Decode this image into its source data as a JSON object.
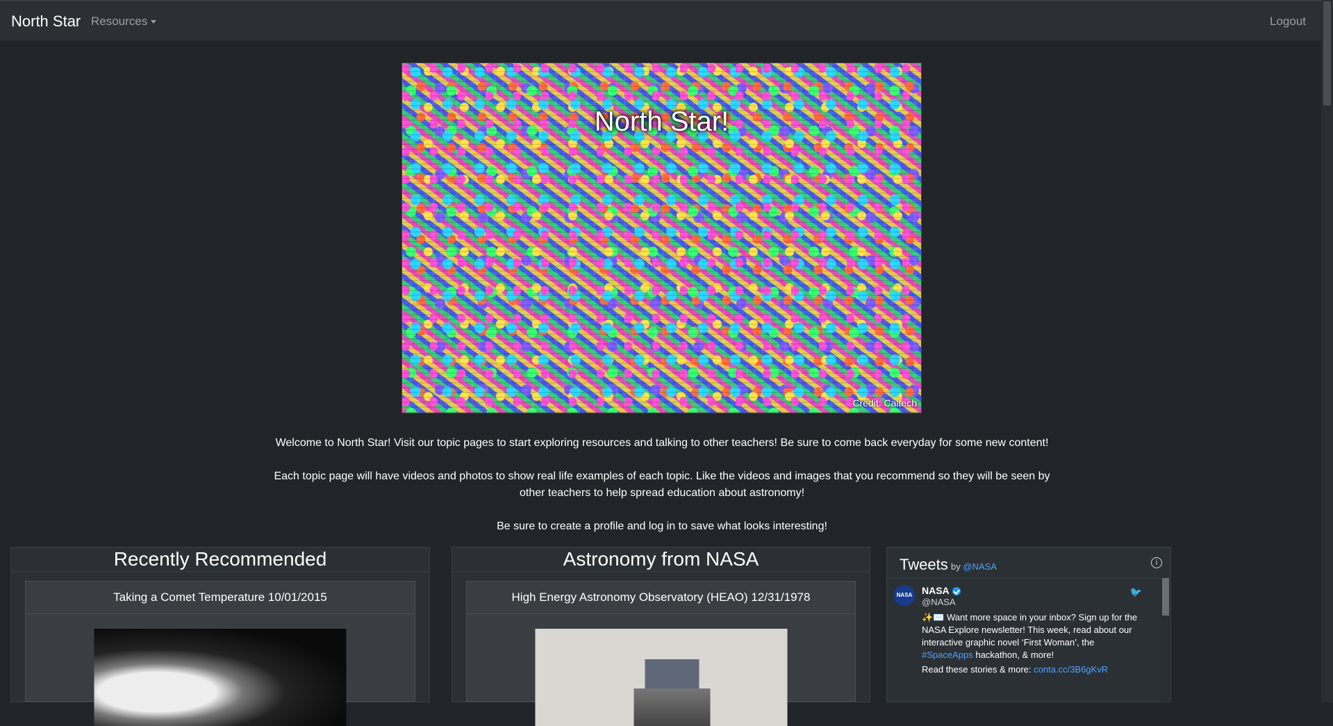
{
  "nav": {
    "brand": "North Star",
    "resources": "Resources",
    "logout": "Logout"
  },
  "hero": {
    "title": "North Star!",
    "credit": "Credit: Caltech"
  },
  "welcome": {
    "p1": "Welcome to North Star! Visit our topic pages to start exploring resources and talking to other teachers! Be sure to come back everyday for some new content!",
    "p2": "Each topic page will have videos and photos to show real life examples of each topic. Like the videos and images that you recommend so they will be seen by other teachers to help spread education about astronomy!",
    "p3": "Be sure to create a profile and log in to save what looks interesting!"
  },
  "recent": {
    "title": "Recently Recommended",
    "card_title": "Taking a Comet Temperature 10/01/2015"
  },
  "nasa": {
    "title": "Astronomy from NASA",
    "card_title": "High Energy Astronomy Observatory (HEAO) 12/31/1978"
  },
  "tweets": {
    "title": "Tweets",
    "by": "by",
    "handle": "@NASA",
    "tweet": {
      "name": "NASA",
      "handle": "@NASA",
      "emoji": "✨✉️",
      "text_1": " Want more space in your inbox? Sign up for the NASA Explore newsletter! This week, read about our interactive graphic novel ‘First Woman’, the ",
      "hashtag": "#SpaceApps",
      "text_2": " hackathon, & more!",
      "more_prefix": "Read these stories & more: ",
      "more_link": "conta.cc/3B6gKvR"
    }
  },
  "icons": {
    "info": "info-icon",
    "verified": "verified-icon",
    "twitter": "twitter-bird-icon"
  }
}
